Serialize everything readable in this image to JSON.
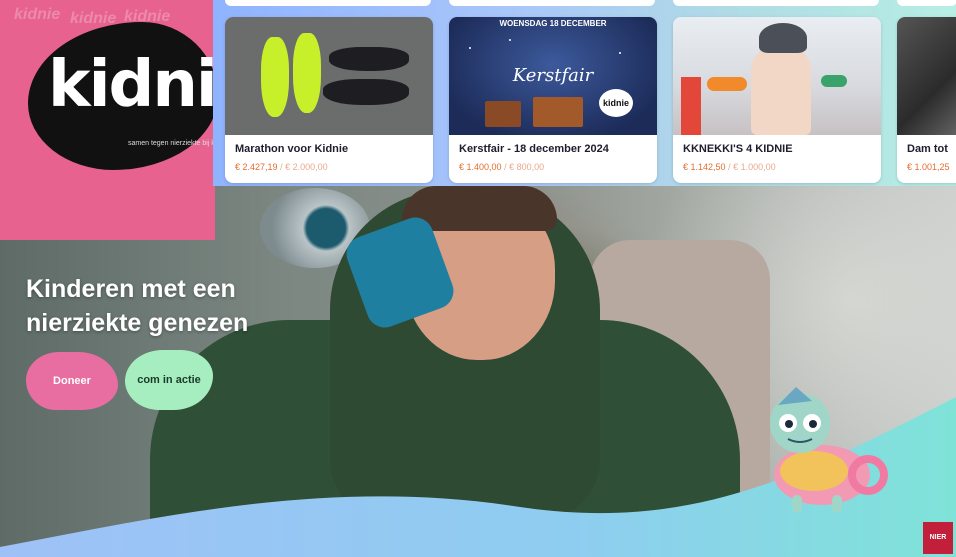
{
  "logo": {
    "text": "kidnie",
    "tagline": "samen tegen nierziekte bij kinderen"
  },
  "pink_panel": {
    "ghost_words": [
      "kidnie",
      "kidnie",
      "kidnie"
    ]
  },
  "hero": {
    "title_line1": "Kinderen met een",
    "title_line2": "nierziekte genezen",
    "buttons": {
      "donate": "Doneer",
      "action": "com in actie"
    }
  },
  "campaigns": [
    {
      "title": "Marathon voor Kidnie",
      "raised": "€ 2.427,19",
      "goal": "€ 2.000,00",
      "image": "running-shoes"
    },
    {
      "title": "Kerstfair - 18 december 2024",
      "raised": "€ 1.400,00",
      "goal": "€ 800,00",
      "image": "kerstfair-poster",
      "poster_head": "WOENSDAG 18 DECEMBER",
      "poster_script": "Kerstfair",
      "poster_badge": "kidnie"
    },
    {
      "title": "KKNEKKI'S 4 KIDNIE",
      "raised": "€ 1.142,50",
      "goal": "€ 1.000,00",
      "image": "child-bracelets"
    },
    {
      "title": "Dam tot",
      "raised": "€ 1.001,25",
      "goal": "",
      "image": "partial-card"
    }
  ],
  "corner_logo": "NIER",
  "colors": {
    "pink": "#e7628f",
    "mint": "#a6eec0",
    "orange_amount": "#e46d2f",
    "strip_start": "#8fb3ff",
    "strip_end": "#b6eee4"
  }
}
